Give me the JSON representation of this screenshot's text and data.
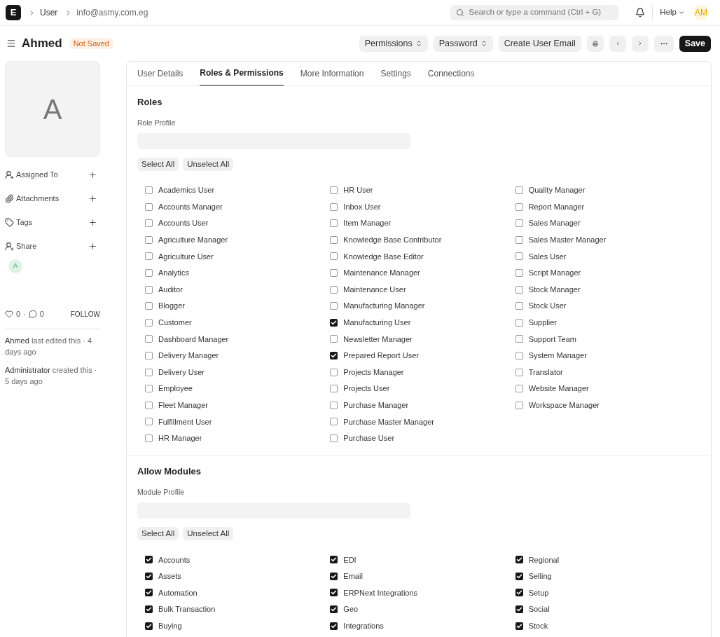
{
  "navbar": {
    "logo": "E",
    "breadcrumbs": [
      "User",
      "info@asmy.com.eg"
    ],
    "search": {
      "placeholder": "Search or type a command (Ctrl + G)"
    },
    "help": "Help",
    "avatar": "AM"
  },
  "header": {
    "title": "Ahmed",
    "status": "Not Saved",
    "buttons": [
      {
        "label": "Permissions",
        "kind": "select"
      },
      {
        "label": "Password",
        "kind": "select"
      },
      {
        "label": "Create User Email",
        "kind": "plain"
      },
      {
        "kind": "print"
      },
      {
        "kind": "prev"
      },
      {
        "kind": "next"
      },
      {
        "kind": "more"
      },
      {
        "label": "Save",
        "kind": "primary"
      }
    ]
  },
  "sidebar": {
    "image_letter": "A",
    "actions": [
      {
        "label": "Assigned To",
        "kind": "assign"
      },
      {
        "label": "Attachments",
        "kind": "attach"
      },
      {
        "label": "Tags",
        "kind": "tag"
      },
      {
        "label": "Share",
        "kind": "share"
      }
    ],
    "shared_with": [
      "A"
    ],
    "likes": "0",
    "separator": "·",
    "comments": "0",
    "follow": "FOLLOW",
    "activity": [
      {
        "who": "Ahmed",
        "text": "last edited this · 4 days ago"
      },
      {
        "who": "Administrator",
        "text": "created this · 5 days ago"
      }
    ]
  },
  "tabs": [
    {
      "label": "User Details",
      "selected": false
    },
    {
      "label": "Roles & Permissions",
      "selected": true
    },
    {
      "label": "More Information",
      "selected": false
    },
    {
      "label": "Settings",
      "selected": false
    },
    {
      "label": "Connections",
      "selected": false
    }
  ],
  "sections": [
    {
      "title": "Roles",
      "profile_label": "Role Profile",
      "buttons": [
        "Select All",
        "Unselect All"
      ],
      "columns": [
        [
          {
            "label": "Academics User",
            "checked": false
          },
          {
            "label": "Accounts Manager",
            "checked": false
          },
          {
            "label": "Accounts User",
            "checked": false
          },
          {
            "label": "Agriculture Manager",
            "checked": false
          },
          {
            "label": "Agriculture User",
            "checked": false
          },
          {
            "label": "Analytics",
            "checked": false
          },
          {
            "label": "Auditor",
            "checked": false
          },
          {
            "label": "Blogger",
            "checked": false
          },
          {
            "label": "Customer",
            "checked": false
          },
          {
            "label": "Dashboard Manager",
            "checked": false
          },
          {
            "label": "Delivery Manager",
            "checked": false
          },
          {
            "label": "Delivery User",
            "checked": false
          },
          {
            "label": "Employee",
            "checked": false
          },
          {
            "label": "Fleet Manager",
            "checked": false
          },
          {
            "label": "Fulfillment User",
            "checked": false
          },
          {
            "label": "HR Manager",
            "checked": false
          }
        ],
        [
          {
            "label": "HR User",
            "checked": false
          },
          {
            "label": "Inbox User",
            "checked": false
          },
          {
            "label": "Item Manager",
            "checked": false
          },
          {
            "label": "Knowledge Base Contributor",
            "checked": false
          },
          {
            "label": "Knowledge Base Editor",
            "checked": false
          },
          {
            "label": "Maintenance Manager",
            "checked": false
          },
          {
            "label": "Maintenance User",
            "checked": false
          },
          {
            "label": "Manufacturing Manager",
            "checked": false
          },
          {
            "label": "Manufacturing User",
            "checked": true
          },
          {
            "label": "Newsletter Manager",
            "checked": false
          },
          {
            "label": "Prepared Report User",
            "checked": true
          },
          {
            "label": "Projects Manager",
            "checked": false
          },
          {
            "label": "Projects User",
            "checked": false
          },
          {
            "label": "Purchase Manager",
            "checked": false
          },
          {
            "label": "Purchase Master Manager",
            "checked": false
          },
          {
            "label": "Purchase User",
            "checked": false
          }
        ],
        [
          {
            "label": "Quality Manager",
            "checked": false
          },
          {
            "label": "Report Manager",
            "checked": false
          },
          {
            "label": "Sales Manager",
            "checked": false
          },
          {
            "label": "Sales Master Manager",
            "checked": false
          },
          {
            "label": "Sales User",
            "checked": false
          },
          {
            "label": "Script Manager",
            "checked": false
          },
          {
            "label": "Stock Manager",
            "checked": false
          },
          {
            "label": "Stock User",
            "checked": false
          },
          {
            "label": "Supplier",
            "checked": false
          },
          {
            "label": "Support Team",
            "checked": false
          },
          {
            "label": "System Manager",
            "checked": false
          },
          {
            "label": "Translator",
            "checked": false
          },
          {
            "label": "Website Manager",
            "checked": false
          },
          {
            "label": "Workspace Manager",
            "checked": false
          }
        ]
      ]
    },
    {
      "title": "Allow Modules",
      "profile_label": "Module Profile",
      "buttons": [
        "Select All",
        "Unselect All"
      ],
      "columns": [
        [
          {
            "label": "Accounts",
            "checked": true
          },
          {
            "label": "Assets",
            "checked": true
          },
          {
            "label": "Automation",
            "checked": true
          },
          {
            "label": "Bulk Transaction",
            "checked": true
          },
          {
            "label": "Buying",
            "checked": true
          }
        ],
        [
          {
            "label": "EDI",
            "checked": true
          },
          {
            "label": "Email",
            "checked": true
          },
          {
            "label": "ERPNext Integrations",
            "checked": true
          },
          {
            "label": "Geo",
            "checked": true
          },
          {
            "label": "Integrations",
            "checked": true
          }
        ],
        [
          {
            "label": "Regional",
            "checked": true
          },
          {
            "label": "Selling",
            "checked": true
          },
          {
            "label": "Setup",
            "checked": true
          },
          {
            "label": "Social",
            "checked": true
          },
          {
            "label": "Stock",
            "checked": true
          }
        ]
      ]
    }
  ]
}
